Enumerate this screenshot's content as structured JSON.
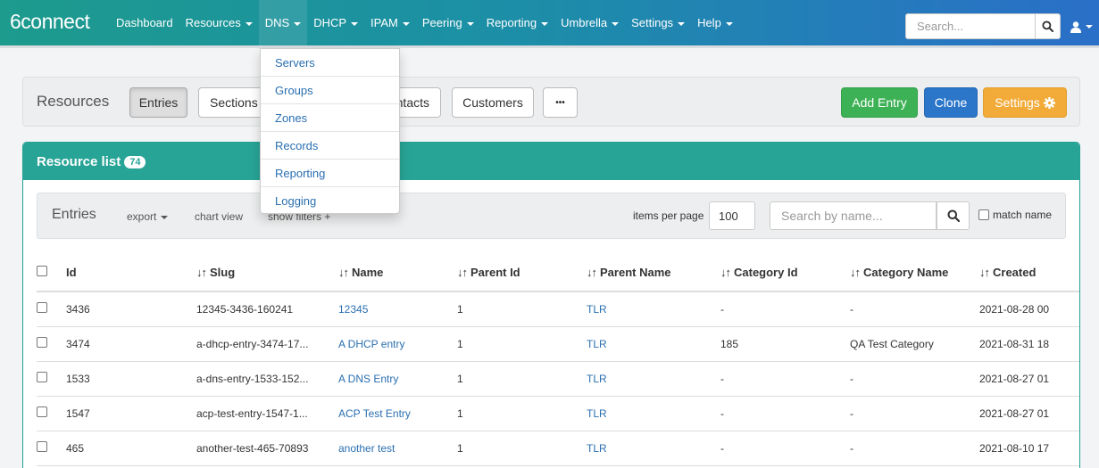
{
  "navbar": {
    "brand": "6connect",
    "items": [
      {
        "label": "Dashboard",
        "caret": false
      },
      {
        "label": "Resources",
        "caret": true
      },
      {
        "label": "DNS",
        "caret": true
      },
      {
        "label": "DHCP",
        "caret": true
      },
      {
        "label": "IPAM",
        "caret": true
      },
      {
        "label": "Peering",
        "caret": true
      },
      {
        "label": "Reporting",
        "caret": true
      },
      {
        "label": "Umbrella",
        "caret": true
      },
      {
        "label": "Settings",
        "caret": true
      },
      {
        "label": "Help",
        "caret": true
      }
    ],
    "search_placeholder": "Search...",
    "icons": {
      "search": "search-icon",
      "user": "user-icon"
    }
  },
  "dns_menu": {
    "items": [
      "Servers",
      "Groups",
      "Zones",
      "Records",
      "Reporting",
      "Logging"
    ]
  },
  "toolbar": {
    "title": "Resources",
    "buttons": [
      "Entries",
      "Sections",
      "Contacts",
      "Customers",
      "•••"
    ],
    "visible_contacts_fragment": "ntacts",
    "add_entry": "Add Entry",
    "clone": "Clone",
    "settings": "Settings"
  },
  "panel": {
    "title": "Resource list",
    "count": "74"
  },
  "filterbar": {
    "title": "Entries",
    "export": "export",
    "chart_view": "chart view",
    "show_filters": "show filters +",
    "items_per_page_label": "items per page",
    "items_per_page_value": "100",
    "search_placeholder": "Search by name...",
    "match_name": "match name"
  },
  "table": {
    "columns": [
      "Id",
      "Slug",
      "Name",
      "Parent Id",
      "Parent Name",
      "Category Id",
      "Category Name",
      "Created"
    ],
    "rows": [
      [
        "3436",
        "12345-3436-160241",
        "12345",
        "1",
        "TLR",
        "-",
        "-",
        "2021-08-28 00"
      ],
      [
        "3474",
        "a-dhcp-entry-3474-17...",
        "A DHCP entry",
        "1",
        "TLR",
        "185",
        "QA Test Category",
        "2021-08-31 18"
      ],
      [
        "1533",
        "a-dns-entry-1533-152...",
        "A DNS Entry",
        "1",
        "TLR",
        "-",
        "-",
        "2021-08-27 01"
      ],
      [
        "1547",
        "acp-test-entry-1547-1...",
        "ACP Test Entry",
        "1",
        "TLR",
        "-",
        "-",
        "2021-08-27 01"
      ],
      [
        "465",
        "another-test-465-70893",
        "another test",
        "1",
        "TLR",
        "-",
        "-",
        "2021-08-10 17"
      ]
    ]
  },
  "colors": {
    "teal": "#28a497",
    "navbar_right": "#2a6fc8",
    "link": "#2a6fb0",
    "green": "#3db155",
    "blue": "#2b76c9",
    "orange": "#f2ab38"
  }
}
